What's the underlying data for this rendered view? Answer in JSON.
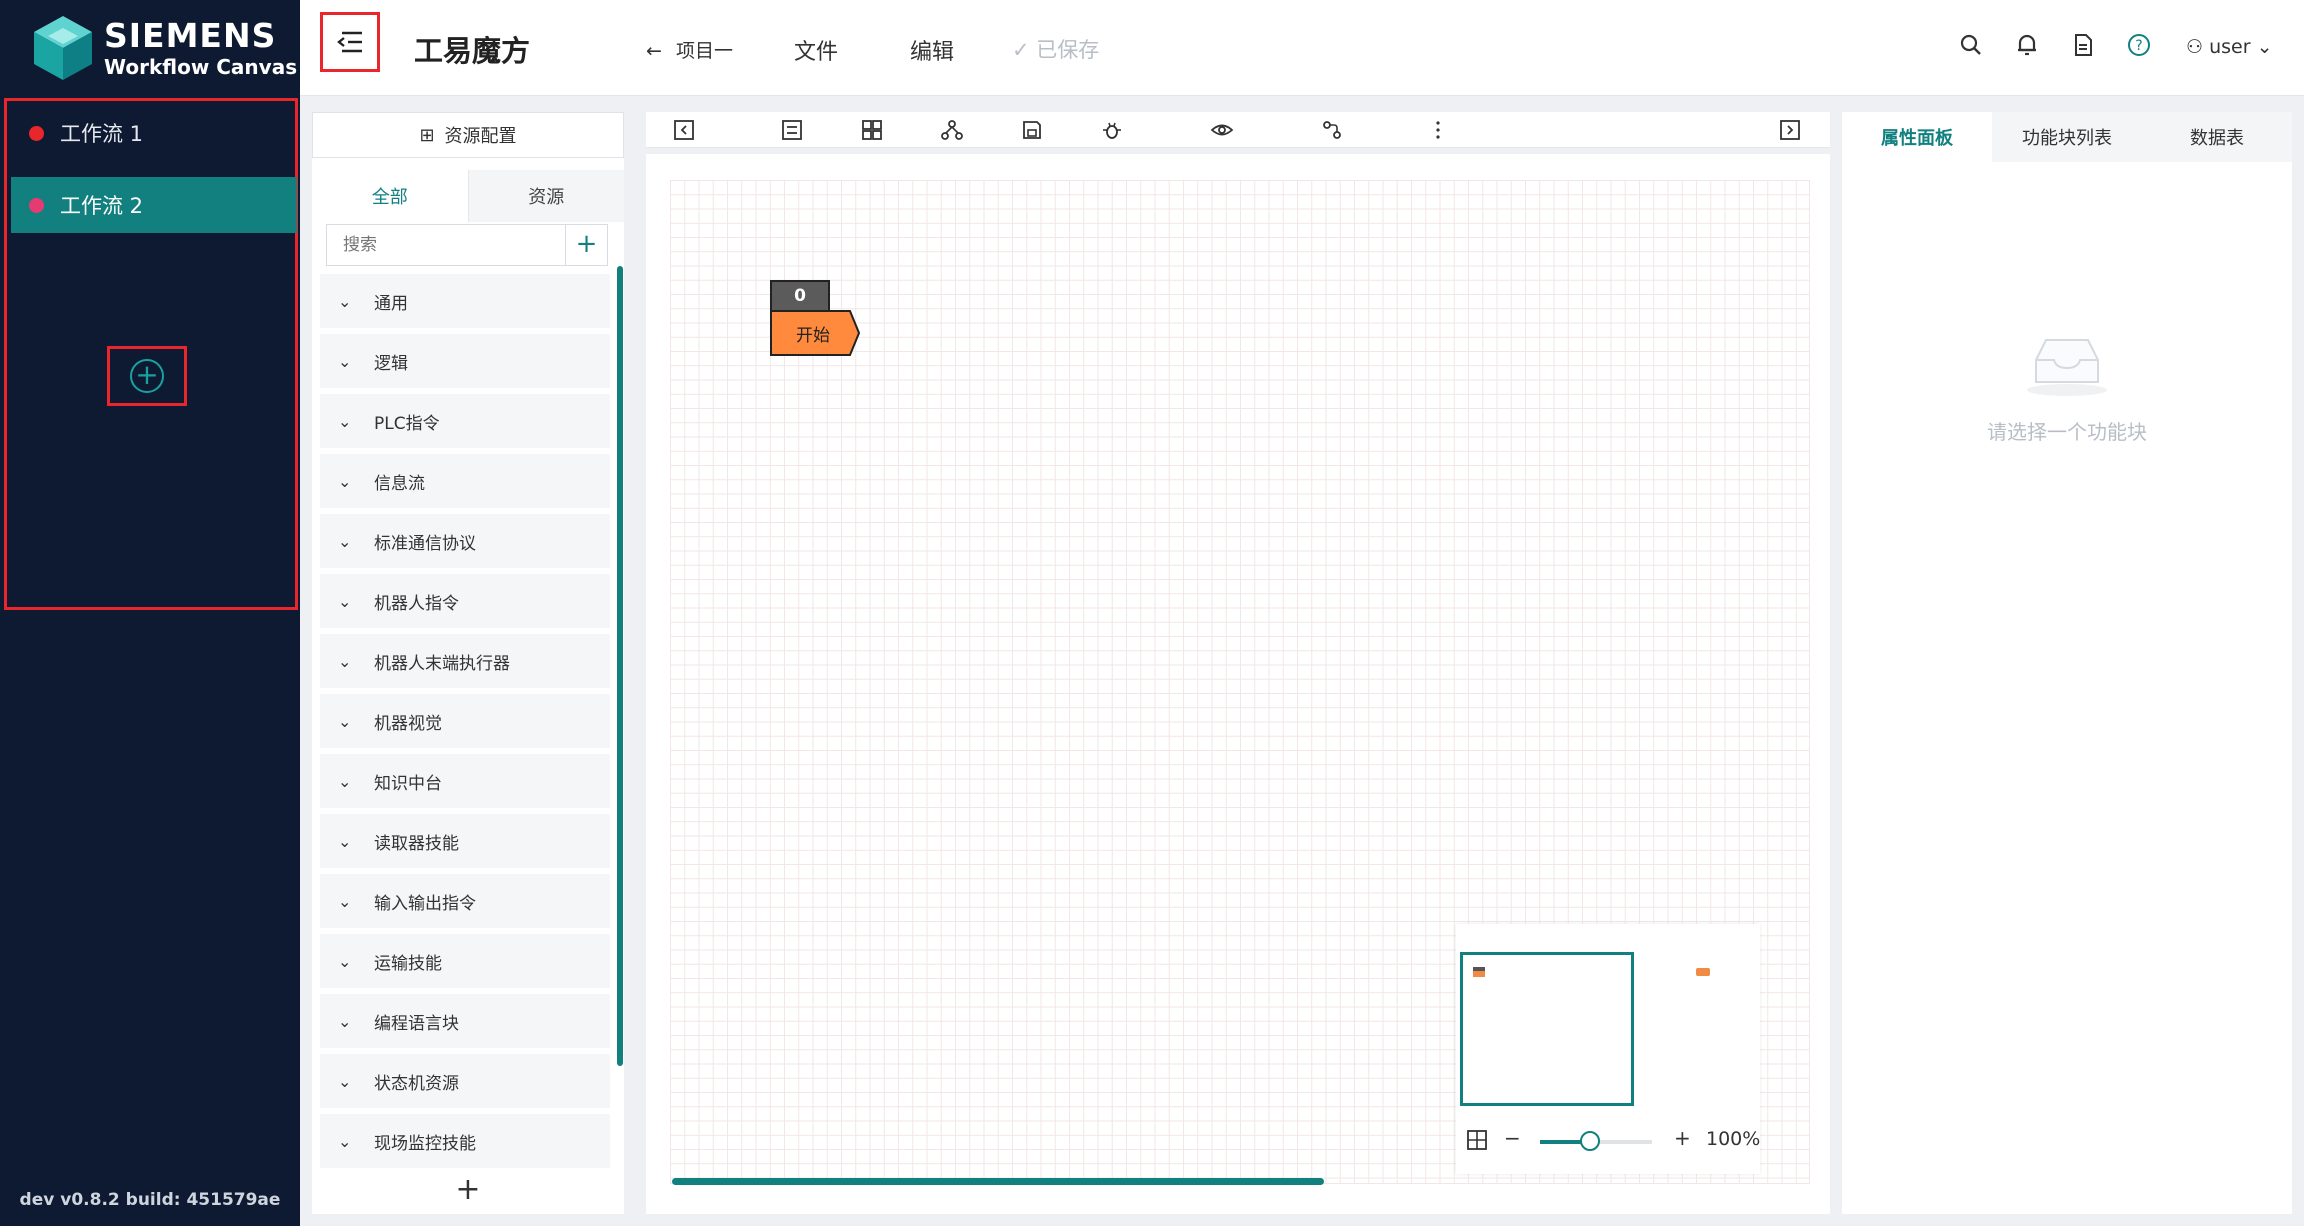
{
  "brand": {
    "name": "SIEMENS",
    "product": "Workflow Canvas"
  },
  "sidebar": {
    "workflows": [
      {
        "label": "工作流 1",
        "dot_color": "#e8262b"
      },
      {
        "label": "工作流 2",
        "dot_color": "#e63a73"
      }
    ],
    "add_symbol": "+",
    "version": "dev v0.8.2 build: 451579ae"
  },
  "header": {
    "title": "工易魔方",
    "project": "项目一",
    "menus": [
      "文件",
      "编辑"
    ],
    "saved": "已保存",
    "user": "user"
  },
  "resources": {
    "config_label": "资源配置",
    "tabs": [
      "全部",
      "资源"
    ],
    "search_placeholder": "搜索",
    "add_symbol": "+",
    "categories": [
      "通用",
      "逻辑",
      "PLC指令",
      "信息流",
      "标准通信协议",
      "机器人指令",
      "机器人末端执行器",
      "机器视觉",
      "知识中台",
      "读取器技能",
      "输入输出指令",
      "运输技能",
      "编程语言块",
      "状态机资源",
      "现场监控技能"
    ],
    "bottom_add": "+"
  },
  "canvas": {
    "node_index": "0",
    "node_label": "开始",
    "node_color": "#ff8a3d",
    "zoom": "100%",
    "zoom_level": 0.45,
    "zoom_out": "−",
    "zoom_in": "+"
  },
  "properties": {
    "tabs": [
      "属性面板",
      "功能块列表",
      "数据表"
    ],
    "empty_text": "请选择一个功能块"
  },
  "colors": {
    "accent": "#12807f",
    "sidebar_bg": "#0e1a31",
    "highlight": "#e8262b"
  }
}
